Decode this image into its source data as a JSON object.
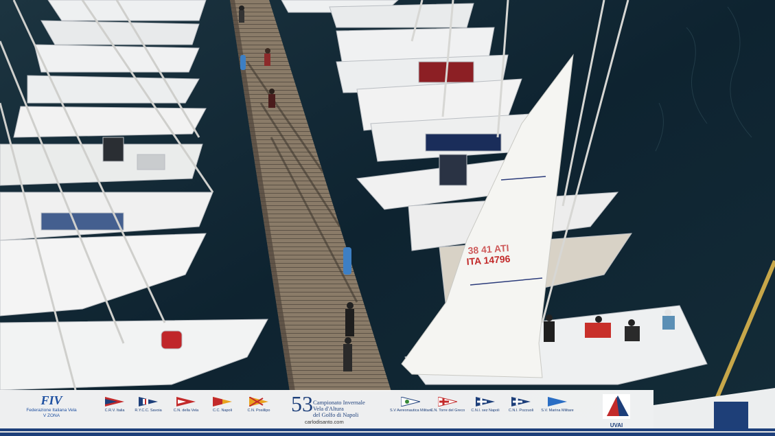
{
  "photo": {
    "subject": "aerial-marina",
    "sail_number_text": "ITA 14796",
    "sail_number_mirror_text": "38 41 ATI"
  },
  "banner": {
    "federation": {
      "logo_text": "FIV",
      "name": "Federazione Italiana Vela",
      "zone": "V ZONA"
    },
    "clubs_left": [
      {
        "label": "C.R.V. Italia"
      },
      {
        "label": "R.Y.C.C. Savoia"
      },
      {
        "label": "C.N. della Vela"
      },
      {
        "label": "C.C. Napoli"
      },
      {
        "label": "C.N. Posillipo"
      }
    ],
    "event": {
      "number": "53",
      "line1": "Campionato Invernale",
      "line2": "Vela d'Altura",
      "line3": "del Golfo di Napoli",
      "website": "carlodisanto.com"
    },
    "clubs_right": [
      {
        "label": "S.V Aereonautica Militare"
      },
      {
        "label": "C.N. Torre del Greco"
      },
      {
        "label": "C.N.I. sez Napoli"
      },
      {
        "label": "C.N.I. Pozzuoli"
      },
      {
        "label": "S.V. Marina Militare"
      }
    ],
    "uvai": {
      "label": "UVAI"
    }
  },
  "colors": {
    "banner_blue": "#1d3f7a",
    "water": "#0f2430",
    "dock": "#8a7b68",
    "hull": "#f2f2f0"
  }
}
